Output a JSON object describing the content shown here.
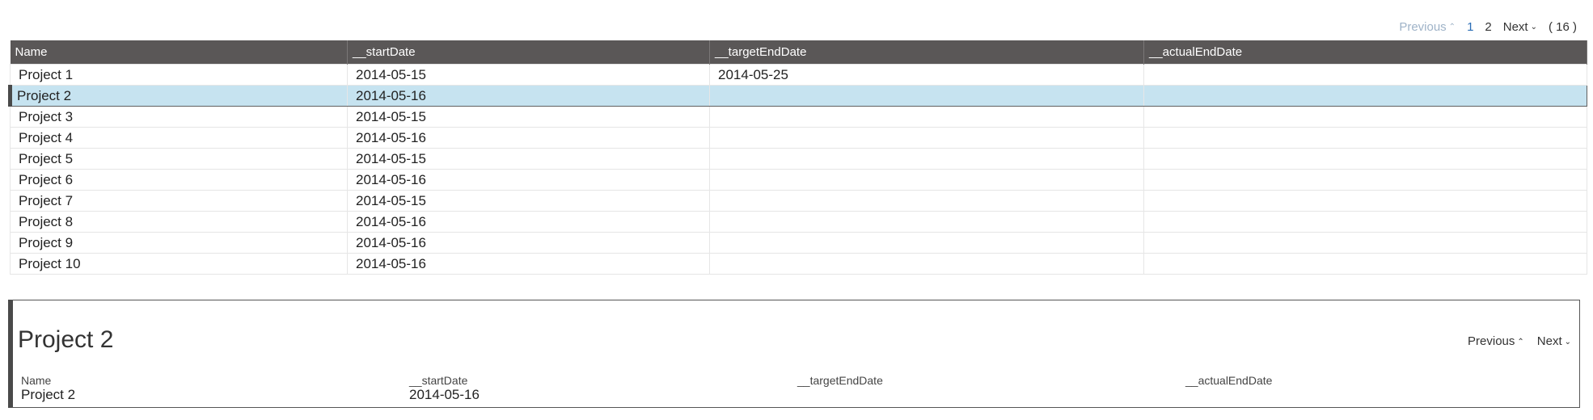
{
  "pager": {
    "previous": "Previous",
    "pages": [
      "1",
      "2"
    ],
    "next": "Next",
    "count": "( 16 )"
  },
  "table": {
    "columns": [
      "Name",
      "__startDate",
      "__targetEndDate",
      "__actualEndDate"
    ],
    "rows": [
      {
        "name": "Project 1",
        "start": "2014-05-15",
        "target": "2014-05-25",
        "actual": ""
      },
      {
        "name": "Project 2",
        "start": "2014-05-16",
        "target": "",
        "actual": ""
      },
      {
        "name": "Project 3",
        "start": "2014-05-15",
        "target": "",
        "actual": ""
      },
      {
        "name": "Project 4",
        "start": "2014-05-16",
        "target": "",
        "actual": ""
      },
      {
        "name": "Project 5",
        "start": "2014-05-15",
        "target": "",
        "actual": ""
      },
      {
        "name": "Project 6",
        "start": "2014-05-16",
        "target": "",
        "actual": ""
      },
      {
        "name": "Project 7",
        "start": "2014-05-15",
        "target": "",
        "actual": ""
      },
      {
        "name": "Project 8",
        "start": "2014-05-16",
        "target": "",
        "actual": ""
      },
      {
        "name": "Project 9",
        "start": "2014-05-16",
        "target": "",
        "actual": ""
      },
      {
        "name": "Project 10",
        "start": "2014-05-16",
        "target": "",
        "actual": ""
      }
    ],
    "selected_row": "Project 2"
  },
  "detail": {
    "title": "Project 2",
    "previous": "Previous",
    "next": "Next",
    "fields": [
      {
        "label": "Name",
        "value": "Project 2"
      },
      {
        "label": "__startDate",
        "value": "2014-05-16"
      },
      {
        "label": "__targetEndDate",
        "value": ""
      },
      {
        "label": "__actualEndDate",
        "value": ""
      }
    ]
  },
  "colors": {
    "header_bg": "#5a5757",
    "selected_bg": "#c6e3f0",
    "link_active": "#2a6db5",
    "link_disabled": "#9fb3c8"
  }
}
